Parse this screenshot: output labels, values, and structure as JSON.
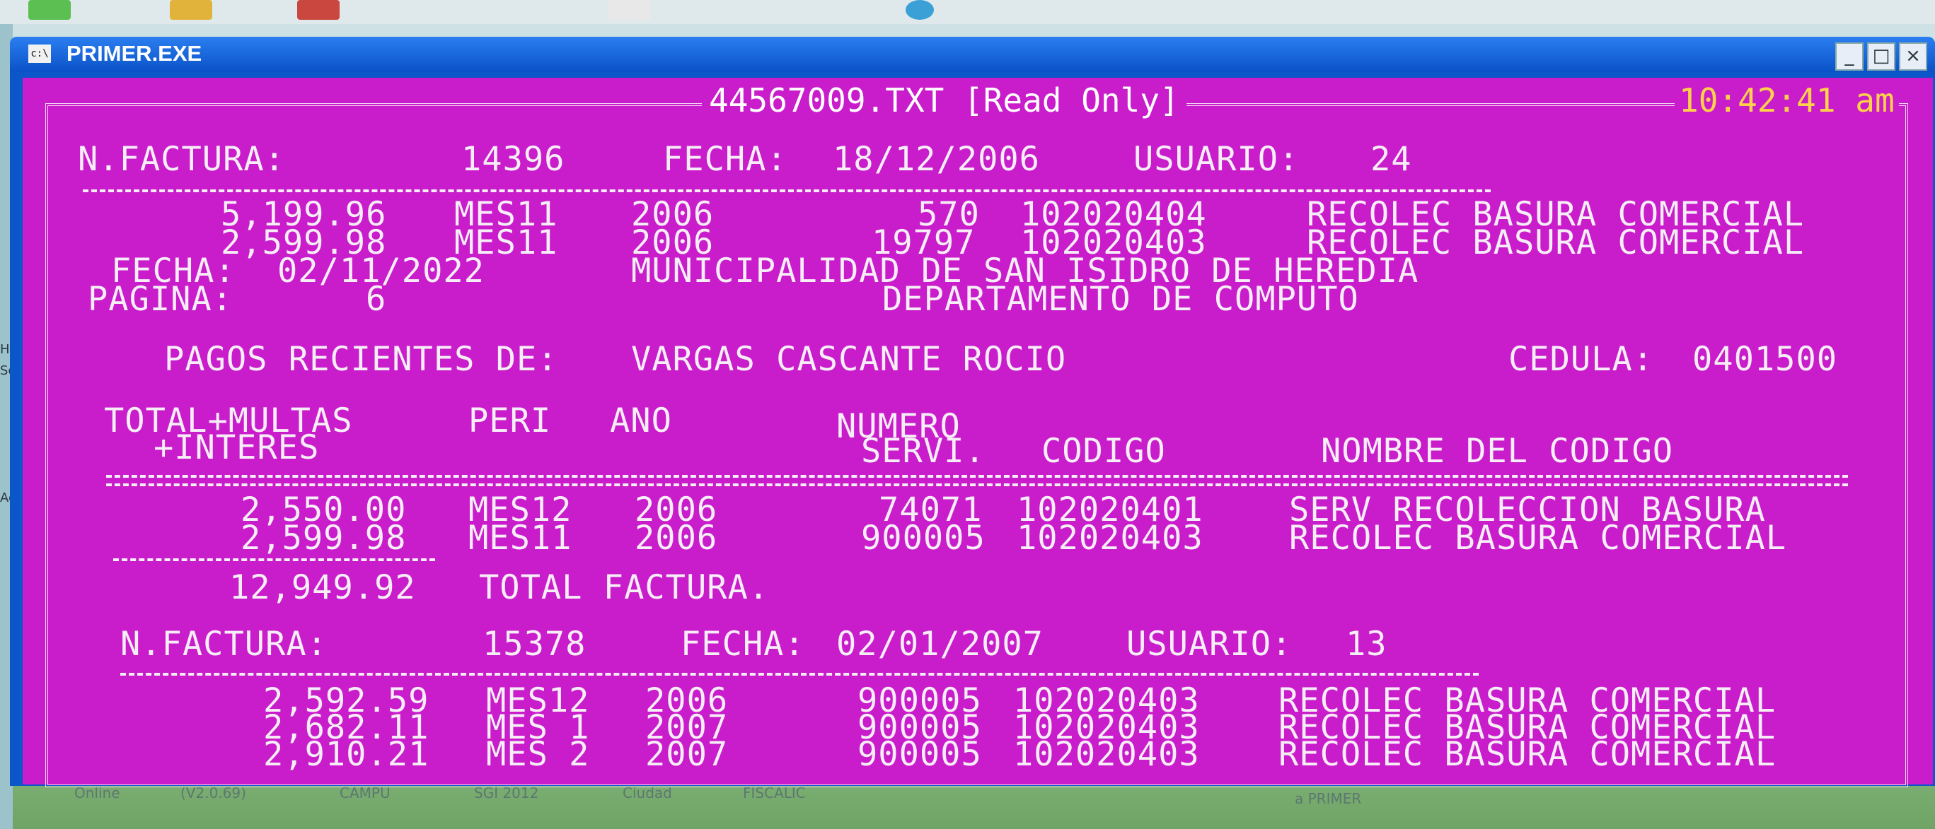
{
  "window": {
    "title": "PRIMER.EXE",
    "icon_label": "c:\\",
    "controls": {
      "minimize": "_",
      "maximize": "□",
      "close": "×"
    }
  },
  "console": {
    "file_title": "44567009.TXT [Read Only]",
    "clock": "10:42:41 am",
    "invoice1": {
      "label_factura": "N.FACTURA:",
      "factura": "14396",
      "label_fecha": "FECHA:",
      "fecha": "18/12/2006",
      "label_usuario": "USUARIO:",
      "usuario": "24",
      "rows": [
        {
          "total": "5,199.96",
          "peri": "MES11",
          "ano": "2006",
          "servi": "570",
          "codigo": "102020404",
          "nombre": "RECOLEC BASURA COMERCIAL"
        },
        {
          "total": "2,599.98",
          "peri": "MES11",
          "ano": "2006",
          "servi": "19797",
          "codigo": "102020403",
          "nombre": "RECOLEC BASURA COMERCIAL"
        }
      ]
    },
    "report_header": {
      "fecha_label": "FECHA:",
      "fecha": "02/11/2022",
      "pagina_label": "PAGINA:",
      "pagina": "6",
      "org": "MUNICIPALIDAD DE SAN ISIDRO DE HEREDIA",
      "dept": "DEPARTAMENTO DE COMPUTO",
      "pagos_label": "PAGOS RECIENTES DE:",
      "person": "VARGAS CASCANTE ROCIO",
      "cedula_label": "CEDULA:",
      "cedula": "0401500"
    },
    "columns": {
      "total_multas": "TOTAL+MULTAS",
      "interes": "+INTERES",
      "peri": "PERI",
      "ano": "ANO",
      "numero": "NUMERO",
      "servi": "SERVI.",
      "codigo": "CODIGO",
      "nombre": "NOMBRE DEL CODIGO"
    },
    "payments": [
      {
        "total": "2,550.00",
        "peri": "MES12",
        "ano": "2006",
        "servi": "74071",
        "codigo": "102020401",
        "nombre": "SERV RECOLECCION BASURA"
      },
      {
        "total": "2,599.98",
        "peri": "MES11",
        "ano": "2006",
        "servi": "900005",
        "codigo": "102020403",
        "nombre": "RECOLEC BASURA COMERCIAL"
      }
    ],
    "total_factura": "12,949.92",
    "total_factura_label": "TOTAL FACTURA.",
    "invoice2": {
      "label_factura": "N.FACTURA:",
      "factura": "15378",
      "label_fecha": "FECHA:",
      "fecha": "02/01/2007",
      "label_usuario": "USUARIO:",
      "usuario": "13",
      "rows": [
        {
          "total": "2,592.59",
          "peri": "MES12",
          "ano": "2006",
          "servi": "900005",
          "codigo": "102020403",
          "nombre": "RECOLEC BASURA COMERCIAL"
        },
        {
          "total": "2,682.11",
          "peri": "MES 1",
          "ano": "2007",
          "servi": "900005",
          "codigo": "102020403",
          "nombre": "RECOLEC BASURA COMERCIAL"
        },
        {
          "total": "2,910.21",
          "peri": "MES 2",
          "ano": "2007",
          "servi": "900005",
          "codigo": "102020403",
          "nombre": "RECOLEC BASURA COMERCIAL"
        }
      ]
    }
  },
  "desktop": {
    "left_labels": [
      "HP",
      "Sca",
      "Ado"
    ],
    "bottom_labels": [
      "Online",
      "(V2.0.69)",
      "CAMPU",
      "SGI 2012",
      "Ciudad",
      "FISCALIC",
      "a PRIMER"
    ]
  }
}
